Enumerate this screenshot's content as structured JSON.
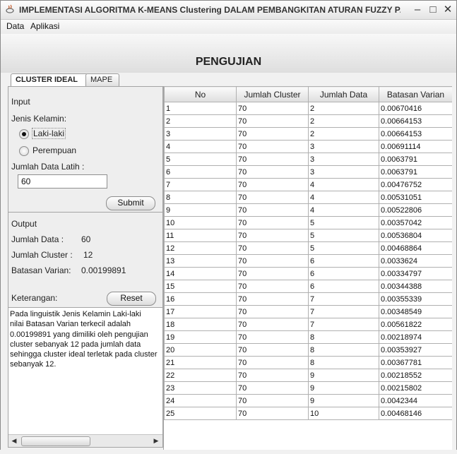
{
  "window": {
    "title": "IMPLEMENTASI ALGORITMA K-MEANS Clustering DALAM PEMBANGKITAN ATURAN FUZZY PAD..."
  },
  "menu": {
    "items": [
      "Data",
      "Aplikasi"
    ]
  },
  "header": {
    "title": "PENGUJIAN"
  },
  "tabs": [
    "CLUSTER IDEAL",
    "MAPE"
  ],
  "input": {
    "section_label": "Input",
    "gender_label": "Jenis Kelamin:",
    "options": [
      "Laki-laki",
      "Perempuan"
    ],
    "selected": "Laki-laki",
    "training_label": "Jumlah Data Latih  :",
    "training_value": "60",
    "submit_label": "Submit"
  },
  "output": {
    "section_label": "Output",
    "jumlah_data_label": "Jumlah Data   :",
    "jumlah_data_value": "60",
    "jumlah_cluster_label": "Jumlah Cluster :",
    "jumlah_cluster_value": "12",
    "batasan_label": "Batasan Varian:",
    "batasan_value": "0.00199891",
    "keterangan_label": "Keterangan:",
    "reset_label": "Reset",
    "keterangan_text": "Pada linguistik Jenis Kelamin Laki-laki\nnilai Batasan Varian terkecil adalah\n0.00199891 yang dimiliki oleh pengujian\ncluster sebanyak 12 pada jumlah data\nsehingga cluster ideal terletak pada cluster\nsebanyak 12."
  },
  "table": {
    "columns": [
      "No",
      "Jumlah Cluster",
      "Jumlah Data",
      "Batasan Varian"
    ],
    "rows": [
      [
        "1",
        "70",
        "2",
        "0.00670416"
      ],
      [
        "2",
        "70",
        "2",
        "0.00664153"
      ],
      [
        "3",
        "70",
        "2",
        "0.00664153"
      ],
      [
        "4",
        "70",
        "3",
        "0.00691114"
      ],
      [
        "5",
        "70",
        "3",
        "0.0063791"
      ],
      [
        "6",
        "70",
        "3",
        "0.0063791"
      ],
      [
        "7",
        "70",
        "4",
        "0.00476752"
      ],
      [
        "8",
        "70",
        "4",
        "0.00531051"
      ],
      [
        "9",
        "70",
        "4",
        "0.00522806"
      ],
      [
        "10",
        "70",
        "5",
        "0.00357042"
      ],
      [
        "11",
        "70",
        "5",
        "0.00536804"
      ],
      [
        "12",
        "70",
        "5",
        "0.00468864"
      ],
      [
        "13",
        "70",
        "6",
        "0.0033624"
      ],
      [
        "14",
        "70",
        "6",
        "0.00334797"
      ],
      [
        "15",
        "70",
        "6",
        "0.00344388"
      ],
      [
        "16",
        "70",
        "7",
        "0.00355339"
      ],
      [
        "17",
        "70",
        "7",
        "0.00348549"
      ],
      [
        "18",
        "70",
        "7",
        "0.00561822"
      ],
      [
        "19",
        "70",
        "8",
        "0.00218974"
      ],
      [
        "20",
        "70",
        "8",
        "0.00353927"
      ],
      [
        "21",
        "70",
        "8",
        "0.00367781"
      ],
      [
        "22",
        "70",
        "9",
        "0.00218552"
      ],
      [
        "23",
        "70",
        "9",
        "0.00215802"
      ],
      [
        "24",
        "70",
        "9",
        "0.0042344"
      ],
      [
        "25",
        "70",
        "10",
        "0.00468146"
      ]
    ]
  }
}
